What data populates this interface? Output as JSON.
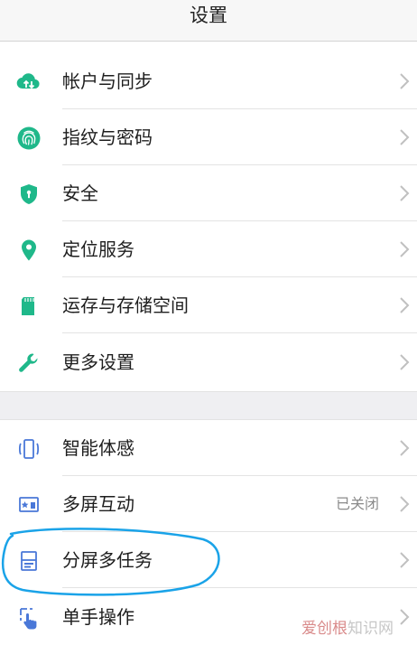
{
  "header": {
    "title": "设置"
  },
  "colors": {
    "accent": "#1fb88a",
    "blue_icon": "#4a78d8",
    "annotation": "#1aa3e8"
  },
  "groups": [
    {
      "items": [
        {
          "label": "帐户与同步",
          "icon": "cloud-sync-icon"
        },
        {
          "label": "指纹与密码",
          "icon": "fingerprint-icon"
        },
        {
          "label": "安全",
          "icon": "shield-icon"
        },
        {
          "label": "定位服务",
          "icon": "location-pin-icon"
        },
        {
          "label": "运存与存储空间",
          "icon": "sd-card-icon"
        },
        {
          "label": "更多设置",
          "icon": "wrench-icon"
        }
      ]
    },
    {
      "items": [
        {
          "label": "智能体感",
          "icon": "phone-motion-icon"
        },
        {
          "label": "多屏互动",
          "icon": "cast-screen-icon",
          "value": "已关闭"
        },
        {
          "label": "分屏多任务",
          "icon": "split-screen-icon"
        },
        {
          "label": "单手操作",
          "icon": "one-hand-icon"
        }
      ]
    }
  ],
  "watermark": {
    "brand": "爱创根",
    "site": "知识网"
  }
}
